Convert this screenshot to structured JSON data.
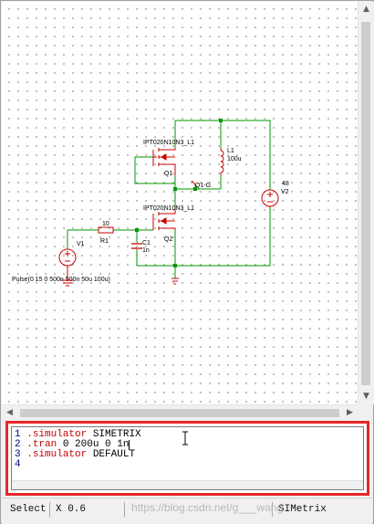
{
  "editor": {
    "lines": [
      {
        "num": "1",
        "keyword": ".simulator",
        "args": " SIMETRIX"
      },
      {
        "num": "2",
        "keyword": ".tran",
        "args": " 0 200u 0 1n"
      },
      {
        "num": "3",
        "keyword": ".simulator",
        "args": " DEFAULT"
      },
      {
        "num": "4",
        "keyword": "",
        "args": ""
      }
    ]
  },
  "status": {
    "mode": "Select",
    "x_coord": "X 0.6",
    "simulator": "SIMetrix"
  },
  "watermark": "https://blog.csdn.net/g___wang",
  "schematic": {
    "q1": {
      "model": "IPT020N10N3_L1",
      "ref": "Q1"
    },
    "q2": {
      "model": "IPT020N10N3_L1",
      "ref": "Q2"
    },
    "l1": {
      "ref": "L1",
      "value": "100u"
    },
    "probe": {
      "label": "Q1-G"
    },
    "v2": {
      "value": "48",
      "ref": "V2"
    },
    "r1": {
      "value": "10",
      "ref": "R1"
    },
    "c1": {
      "ref": "C1",
      "value": "1n"
    },
    "v1": {
      "ref": "V1",
      "value": "Pulse(0 15 0 500n 500n 50u 100u)"
    }
  },
  "colors": {
    "wire": "#009900",
    "component": "#cc0000",
    "highlight": "#e8262a"
  }
}
